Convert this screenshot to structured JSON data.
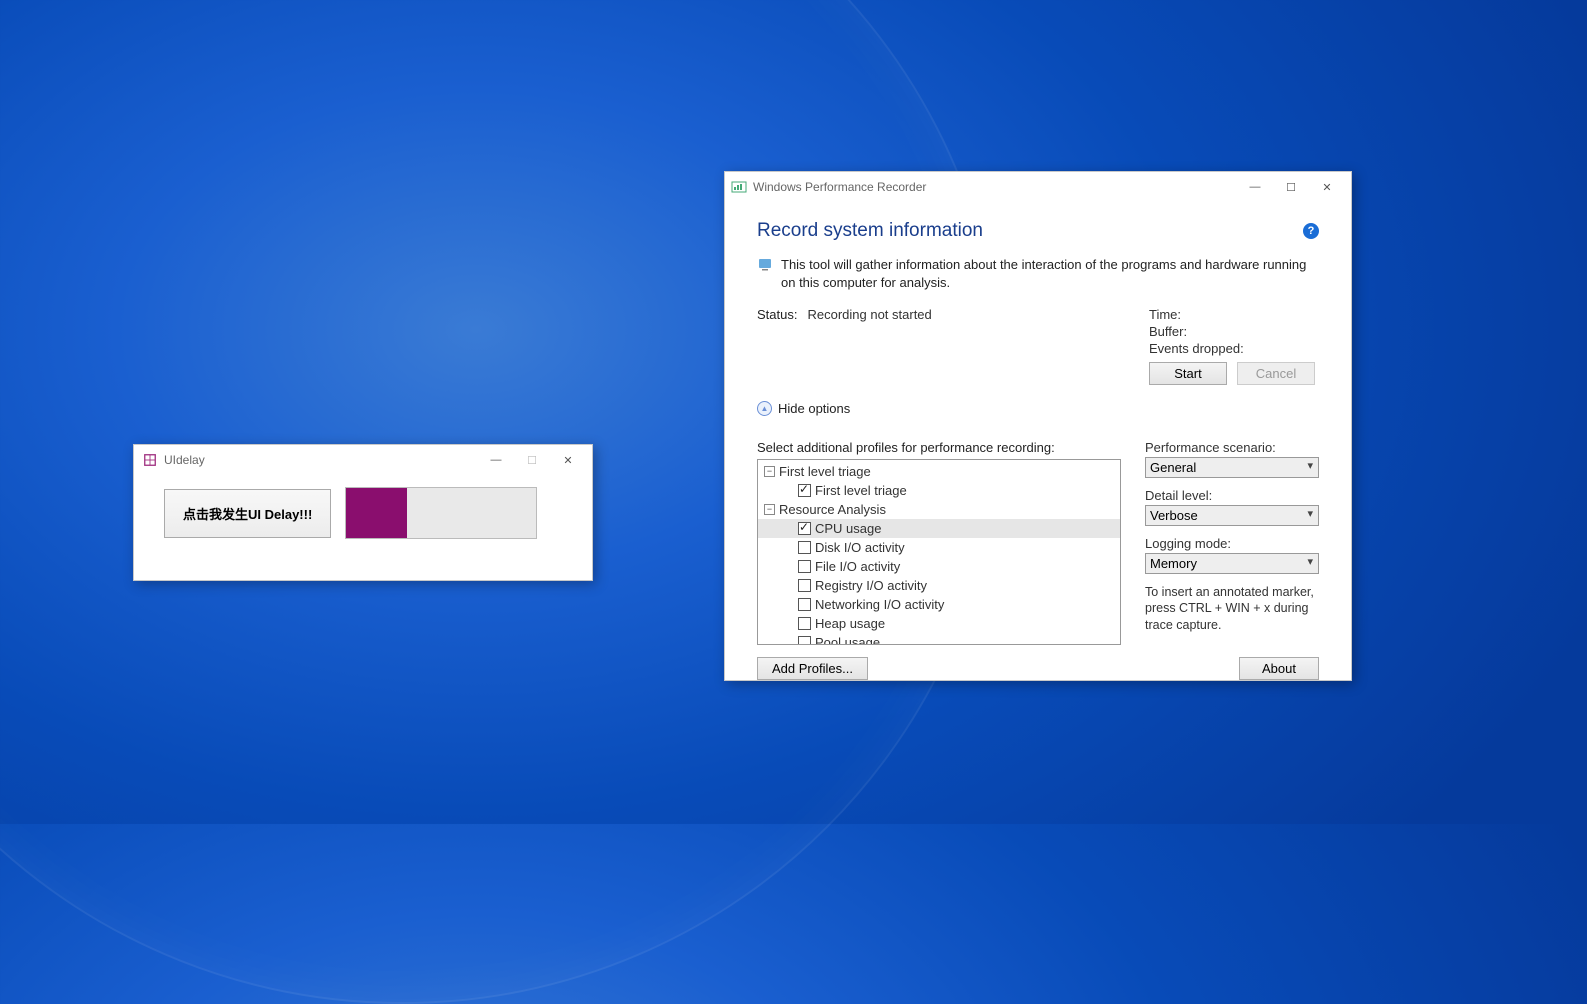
{
  "uidelay": {
    "title": "UIdelay",
    "button_label": "点击我发生UI Delay!!!",
    "progress_percent": 32
  },
  "wpr": {
    "title": "Windows Performance Recorder",
    "heading": "Record system information",
    "description": "This tool will gather information about the interaction of the programs and hardware running on this computer for analysis.",
    "status_label": "Status:",
    "status_value": "Recording not started",
    "time_label": "Time:",
    "buffer_label": "Buffer:",
    "events_dropped_label": "Events dropped:",
    "start_label": "Start",
    "cancel_label": "Cancel",
    "hide_options_label": "Hide options",
    "profiles_label": "Select additional profiles for performance recording:",
    "tree": {
      "group1": "First level triage",
      "item1": "First level triage",
      "group2": "Resource Analysis",
      "item2": "CPU usage",
      "item3": "Disk I/O activity",
      "item4": "File I/O activity",
      "item5": "Registry I/O activity",
      "item6": "Networking I/O activity",
      "item7": "Heap usage",
      "item8": "Pool usage"
    },
    "perf_scenario_label": "Performance scenario:",
    "perf_scenario_value": "General",
    "detail_level_label": "Detail level:",
    "detail_level_value": "Verbose",
    "logging_mode_label": "Logging mode:",
    "logging_mode_value": "Memory",
    "marker_note": "To insert an annotated marker, press CTRL + WIN + x during trace capture.",
    "add_profiles_label": "Add Profiles...",
    "about_label": "About"
  }
}
